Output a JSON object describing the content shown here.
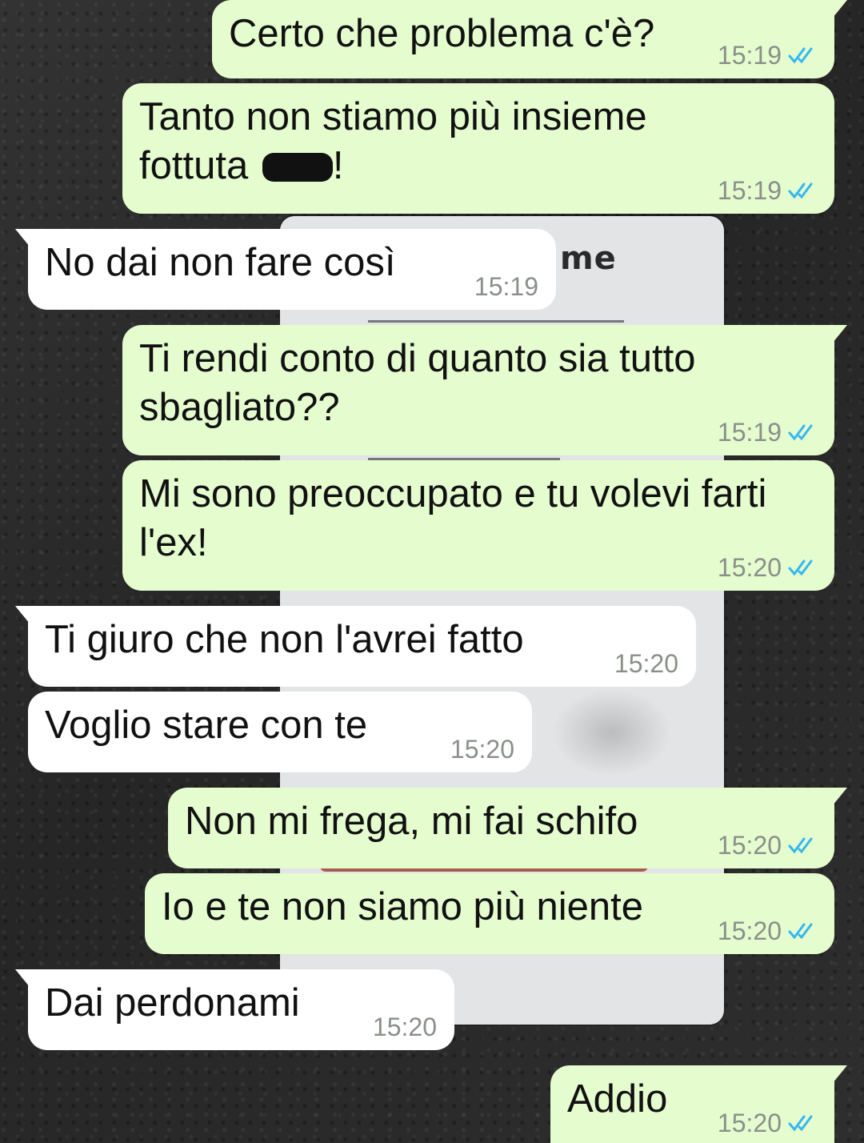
{
  "colors": {
    "outgoing_bubble": "#e5fccf",
    "incoming_bubble": "#ffffff",
    "read_ticks": "#34b7f1",
    "timestamp": "#8a8f8a"
  },
  "background_poster": {
    "text": "me"
  },
  "messages": [
    {
      "direction": "out",
      "text": "Certo che problema c'è?",
      "time": "15:19",
      "status_icon": "double-check-read-icon"
    },
    {
      "direction": "out",
      "text_before": "Tanto non stiamo più insieme\nfottuta ",
      "text_after": "!",
      "time": "15:19",
      "status_icon": "double-check-read-icon"
    },
    {
      "direction": "in",
      "text": "No dai non fare così",
      "time": "15:19"
    },
    {
      "direction": "out",
      "text": "Ti rendi conto di quanto sia tutto\nsbagliato??",
      "time": "15:19",
      "status_icon": "double-check-read-icon"
    },
    {
      "direction": "out",
      "text": "Mi sono preoccupato e tu volevi farti\nl'ex!",
      "time": "15:20",
      "status_icon": "double-check-read-icon"
    },
    {
      "direction": "in",
      "text": "Ti giuro che non l'avrei fatto",
      "time": "15:20"
    },
    {
      "direction": "in",
      "text": "Voglio stare con te",
      "time": "15:20"
    },
    {
      "direction": "out",
      "text": "Non mi frega, mi fai schifo",
      "time": "15:20",
      "status_icon": "double-check-read-icon"
    },
    {
      "direction": "out",
      "text": "Io e te non siamo più niente",
      "time": "15:20",
      "status_icon": "double-check-read-icon"
    },
    {
      "direction": "in",
      "text": "Dai perdonami",
      "time": "15:20"
    },
    {
      "direction": "out",
      "text": "Addio",
      "time": "15:20",
      "status_icon": "double-check-read-icon"
    }
  ]
}
